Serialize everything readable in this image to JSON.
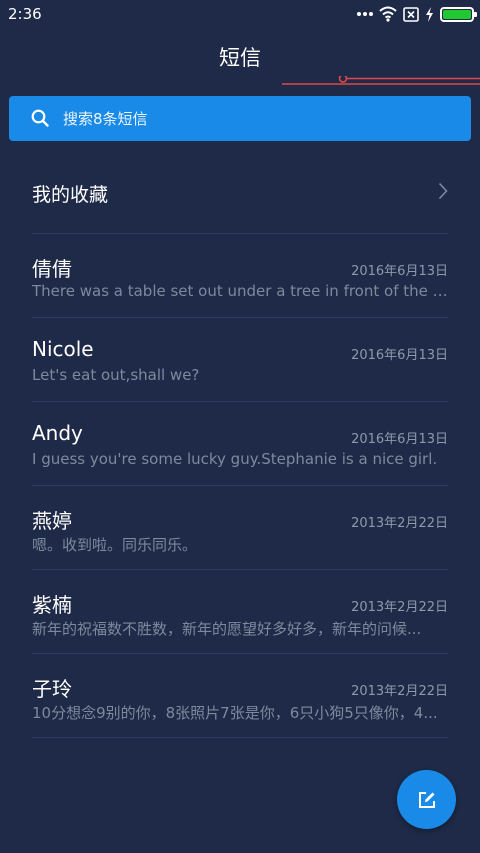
{
  "status_bar": {
    "time": "2:36",
    "icons": [
      "more-dots-icon",
      "wifi-icon",
      "sim-x-icon",
      "charging-icon",
      "battery-icon"
    ],
    "battery_color": "#22c832"
  },
  "header": {
    "title": "短信"
  },
  "search": {
    "placeholder": "搜索8条短信",
    "icon": "search-icon",
    "color": "#1a8ae8"
  },
  "favorites": {
    "label": "我的收藏",
    "icon": "chevron-right-icon"
  },
  "conversations": [
    {
      "name": "倩倩",
      "date": "2016年6月13日",
      "preview": "There was a table set out under a tree in front of the ho..."
    },
    {
      "name": "Nicole",
      "date": "2016年6月13日",
      "preview": "Let's eat out,shall we?"
    },
    {
      "name": "Andy",
      "date": "2016年6月13日",
      "preview": "I guess you're some lucky guy.Stephanie is a nice girl."
    },
    {
      "name": "燕婷",
      "date": "2013年2月22日",
      "preview": "嗯。收到啦。同乐同乐。"
    },
    {
      "name": "紫楠",
      "date": "2013年2月22日",
      "preview": "新年的祝福数不胜数，新年的愿望好多好多，新年的问候..."
    },
    {
      "name": "子玲",
      "date": "2013年2月22日",
      "preview": "10分想念9别的你，8张照片7张是你，6只小狗5只像你，4..."
    }
  ],
  "fab": {
    "icon": "compose-icon",
    "color": "#1a8ae8"
  },
  "colors": {
    "background": "#1e2a47",
    "accent": "#1a8ae8",
    "divider": "#2e3b5a"
  }
}
